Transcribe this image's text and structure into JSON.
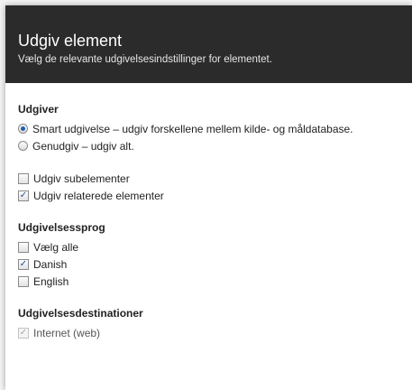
{
  "dialog": {
    "title": "Udgiv element",
    "subtitle": "Vælg de relevante udgivelsesindstillinger for elementet."
  },
  "publisher": {
    "heading": "Udgiver",
    "options": [
      {
        "label": "Smart udgivelse – udgiv forskellene mellem kilde- og måldatabase.",
        "selected": true
      },
      {
        "label": "Genudgiv – udgiv alt.",
        "selected": false
      }
    ]
  },
  "options": {
    "subitems": {
      "label": "Udgiv subelementer",
      "checked": false
    },
    "related": {
      "label": "Udgiv relaterede elementer",
      "checked": true
    }
  },
  "languages": {
    "heading": "Udgivelsessprog",
    "items": [
      {
        "label": "Vælg alle",
        "checked": false
      },
      {
        "label": "Danish",
        "checked": true
      },
      {
        "label": "English",
        "checked": false
      }
    ]
  },
  "targets": {
    "heading": "Udgivelsesdestinationer",
    "items": [
      {
        "label": "Internet (web)",
        "checked": true,
        "disabled": true
      }
    ]
  },
  "colors": {
    "header_bg": "#2b2b2b",
    "check_mark": "#1c4fa0"
  }
}
